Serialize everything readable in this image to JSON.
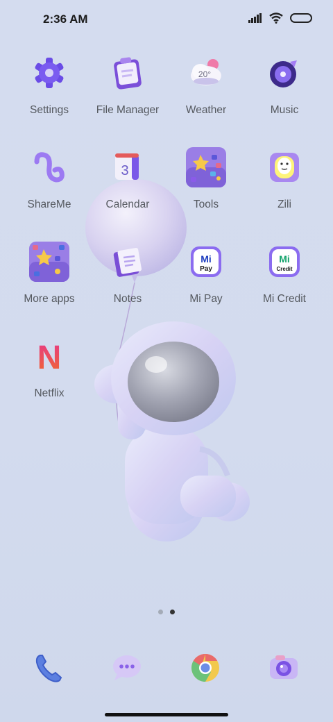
{
  "status_bar": {
    "time": "2:36 AM",
    "icons": [
      "signal-icon",
      "wifi-icon",
      "battery-icon"
    ]
  },
  "apps": [
    {
      "label": "Settings",
      "icon": "gear-icon"
    },
    {
      "label": "File Manager",
      "icon": "clipboard-icon"
    },
    {
      "label": "Weather",
      "icon": "weather-cloud-icon",
      "icon_text": "20°"
    },
    {
      "label": "Music",
      "icon": "music-disc-icon"
    },
    {
      "label": "ShareMe",
      "icon": "infinity-loop-icon"
    },
    {
      "label": "Calendar",
      "icon": "calendar-icon",
      "icon_text": "3"
    },
    {
      "label": "Tools",
      "icon": "folder-grid-icon"
    },
    {
      "label": "Zili",
      "icon": "zili-face-icon"
    },
    {
      "label": "More apps",
      "icon": "folder-grid-icon"
    },
    {
      "label": "Notes",
      "icon": "notebook-icon"
    },
    {
      "label": "Mi Pay",
      "icon": "mi-pay-icon",
      "icon_text": "Pay"
    },
    {
      "label": "Mi Credit",
      "icon": "mi-credit-icon",
      "icon_text": "Credit"
    },
    {
      "label": "Netflix",
      "icon": "netflix-n-icon",
      "icon_text": "N"
    }
  ],
  "dock": [
    {
      "icon": "phone-icon"
    },
    {
      "icon": "messages-icon"
    },
    {
      "icon": "chrome-icon"
    },
    {
      "icon": "camera-icon"
    }
  ],
  "pages": {
    "count": 2,
    "active": 2
  },
  "colors": {
    "background": "#d3dbee",
    "label": "#55595f",
    "accent_purple": "#7d5cf0"
  }
}
